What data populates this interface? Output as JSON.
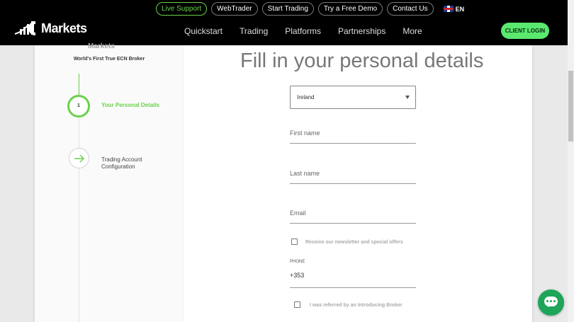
{
  "topbar": {
    "links": [
      "Live Support",
      "WebTrader",
      "Start Trading",
      "Try a Free Demo",
      "Contact Us"
    ],
    "language": "EN"
  },
  "header": {
    "logo_text": "Markets",
    "nav": [
      "Quickstart",
      "Trading",
      "Platforms",
      "Partnerships",
      "More"
    ],
    "login_label": "CLIENT LOGIN"
  },
  "sidebar": {
    "logo_text": "Markets",
    "tagline": "World's First True ECN Broker",
    "step1": {
      "number": "1",
      "label": "Your Personal Details"
    },
    "step2": {
      "label_line1": "Trading Account",
      "label_line2": "Configuration"
    }
  },
  "form": {
    "title": "Fill in your personal details",
    "country": "Ireland",
    "first_name_placeholder": "First name",
    "last_name_placeholder": "Last name",
    "email_placeholder": "Email",
    "newsletter_label": "Receive our newsletter and special offers",
    "phone_label": "PHONE",
    "phone_prefix": "+353",
    "referral_label": "I was referred by an Introducing Broker"
  },
  "colors": {
    "accent_green": "#6ad14b",
    "login_green": "#5ae86f",
    "chat_green": "#1ea55a"
  },
  "icons": [
    "ic-markets-logo-icon",
    "uk-flag-icon",
    "arrow-right-icon",
    "chat-bubble-icon"
  ]
}
